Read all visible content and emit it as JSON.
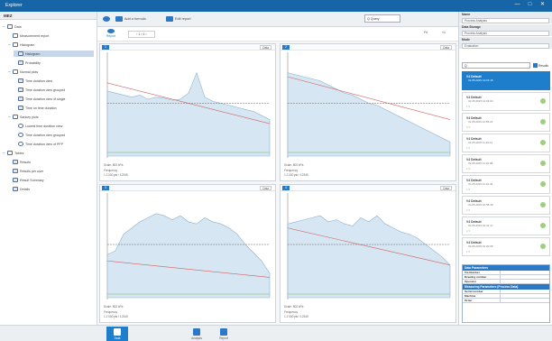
{
  "window": {
    "title": "Explorer",
    "controls": [
      "—",
      "□",
      "✕"
    ]
  },
  "left": {
    "header": "MEZ",
    "tree": [
      {
        "label": "Data",
        "level": 0,
        "toggle": "−",
        "icon": "folder"
      },
      {
        "label": "Measurement report",
        "level": 1,
        "toggle": "",
        "icon": "doc"
      },
      {
        "label": "Histogram",
        "level": 1,
        "toggle": "−",
        "icon": "folder"
      },
      {
        "label": "Histogram",
        "level": 2,
        "toggle": "",
        "icon": "tool",
        "selected": true
      },
      {
        "label": "Probability",
        "level": 2,
        "toggle": "",
        "icon": "tool"
      },
      {
        "label": "Normal plots",
        "level": 1,
        "toggle": "−",
        "icon": "folder"
      },
      {
        "label": "Time duration view",
        "level": 2,
        "toggle": "",
        "icon": "tool"
      },
      {
        "label": "Time duration view grouped",
        "level": 2,
        "toggle": "",
        "icon": "tool"
      },
      {
        "label": "Time duration view of single",
        "level": 2,
        "toggle": "",
        "icon": "tool"
      },
      {
        "label": "Time on time duration",
        "level": 2,
        "toggle": "",
        "icon": "tool"
      },
      {
        "label": "Sankey plots",
        "level": 1,
        "toggle": "−",
        "icon": "folder"
      },
      {
        "label": "Lowest time duration view",
        "level": 2,
        "toggle": "",
        "icon": "circ"
      },
      {
        "label": "Time duration view grouped",
        "level": 2,
        "toggle": "",
        "icon": "circ"
      },
      {
        "label": "Time duration view of PFP",
        "level": 2,
        "toggle": "",
        "icon": "circ"
      },
      {
        "label": "Tables",
        "level": 0,
        "toggle": "−",
        "icon": "doc"
      },
      {
        "label": "Results",
        "level": 1,
        "toggle": "",
        "icon": "tool"
      },
      {
        "label": "Results per user",
        "level": 1,
        "toggle": "",
        "icon": "tool"
      },
      {
        "label": "Result Summary",
        "level": 1,
        "toggle": "",
        "icon": "tool"
      },
      {
        "label": "Details",
        "level": 1,
        "toggle": "",
        "icon": "tool"
      }
    ]
  },
  "toolbar": {
    "btn1": "Add a formula",
    "btn2": "Edit report",
    "search_label": "Q Query",
    "sub_tab": "Report",
    "sub_nav": "‹ 1 / 4 ›",
    "sub_right": [
      "Fit",
      "«1"
    ]
  },
  "panels": [
    {
      "num": "1",
      "btn": "Data",
      "cap1": "Scale: 800 kPa",
      "cap2": "Frequency",
      "cap3": "1.2 000 pts / 12345"
    },
    {
      "num": "2",
      "btn": "Data",
      "cap1": "Scale: 800 kPa",
      "cap2": "Frequency",
      "cap3": "1.2 000 pts / 12345"
    },
    {
      "num": "3",
      "btn": "Data",
      "cap1": "Scale: 800 kPa",
      "cap2": "Frequency",
      "cap3": "1.2 000 pts / 12345"
    },
    {
      "num": "4",
      "btn": "Data",
      "cap1": "Scale: 800 kPa",
      "cap2": "Frequency",
      "cap3": "1.2 000 pts / 12345"
    }
  ],
  "right": {
    "props": [
      {
        "key": "Name",
        "value": "Process Analysis"
      },
      {
        "key": "Data Storage",
        "value": "Process Analysis"
      },
      {
        "key": "Mode",
        "value": "Evaluation"
      }
    ],
    "search_placeholder": "Q",
    "search_button": "Results",
    "snapshots": [
      {
        "name": "V4 Default",
        "date": "31.05.2015 12:15:15",
        "meta": "",
        "selected": true
      },
      {
        "name": "V4 Default",
        "date": "31.05.2015 12:04:04",
        "meta": "1.5",
        "selected": false
      },
      {
        "name": "V4 Default",
        "date": "31.05.2015 11:55:21",
        "meta": "1.5",
        "selected": false
      },
      {
        "name": "V4 Default",
        "date": "31.05.2015 11:40:11",
        "meta": "1.5",
        "selected": false
      },
      {
        "name": "V4 Default",
        "date": "31.05.2015 11:22:08",
        "meta": "1.5",
        "selected": false
      },
      {
        "name": "V4 Default",
        "date": "31.05.2015 11:10:42",
        "meta": "1.5",
        "selected": false
      },
      {
        "name": "V4 Default",
        "date": "31.05.2015 10:58:30",
        "meta": "1.5",
        "selected": false
      },
      {
        "name": "V4 Default",
        "date": "31.05.2015 10:41:17",
        "meta": "1.5",
        "selected": false
      },
      {
        "name": "V4 Default",
        "date": "31.05.2015 10:20:05",
        "meta": "1.5",
        "selected": false
      }
    ],
    "table": {
      "header1": "Data Parameters",
      "rows1": [
        {
          "k": "Tol.Number",
          "v": ""
        },
        {
          "k": "Drawing number",
          "v": ""
        },
        {
          "k": "Operator",
          "v": ""
        }
      ],
      "header2": "Measuring Parameters (Process Data)",
      "rows2": [
        {
          "k": "Serial number",
          "v": ""
        },
        {
          "k": "Machine",
          "v": ""
        },
        {
          "k": "Order",
          "v": ""
        }
      ]
    }
  },
  "bottom": [
    {
      "label": "Data",
      "active": true
    },
    {
      "label": "Analysis",
      "active": false
    },
    {
      "label": "Report",
      "active": false
    }
  ]
}
